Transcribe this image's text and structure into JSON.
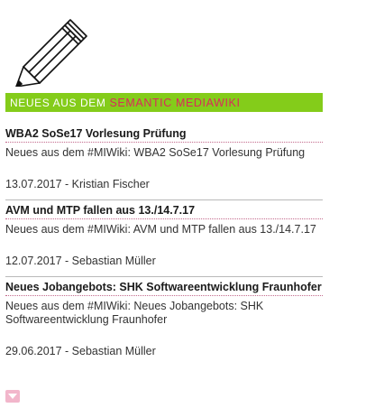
{
  "banner": {
    "prefix": "NEUES AUS DEM",
    "link_text": "SEMANTIC MEDIAWIKI",
    "bg_color": "#84cc1a",
    "link_color": "#d92a5c"
  },
  "posts": [
    {
      "title": "WBA2 SoSe17 Vorlesung Prüfung",
      "body": "Neues aus dem #MIWiki: WBA2 SoSe17 Vorlesung Prüfung",
      "meta": "13.07.2017 - Kristian Fischer"
    },
    {
      "title": "AVM und MTP fallen aus 13./14.7.17",
      "body": "Neues aus dem #MIWiki: AVM und MTP fallen aus 13./14.7.17",
      "meta": "12.07.2017 - Sebastian Müller"
    },
    {
      "title": "Neues Jobangebots: SHK Softwareentwicklung Fraunhofer",
      "body": "Neues aus dem #MIWiki: Neues Jobangebots: SHK Softwareentwicklung Fraunhofer",
      "meta": "29.06.2017 - Sebastian Müller"
    }
  ],
  "icons": {
    "header": "pencil-icon",
    "more": "chevron-down-icon"
  }
}
